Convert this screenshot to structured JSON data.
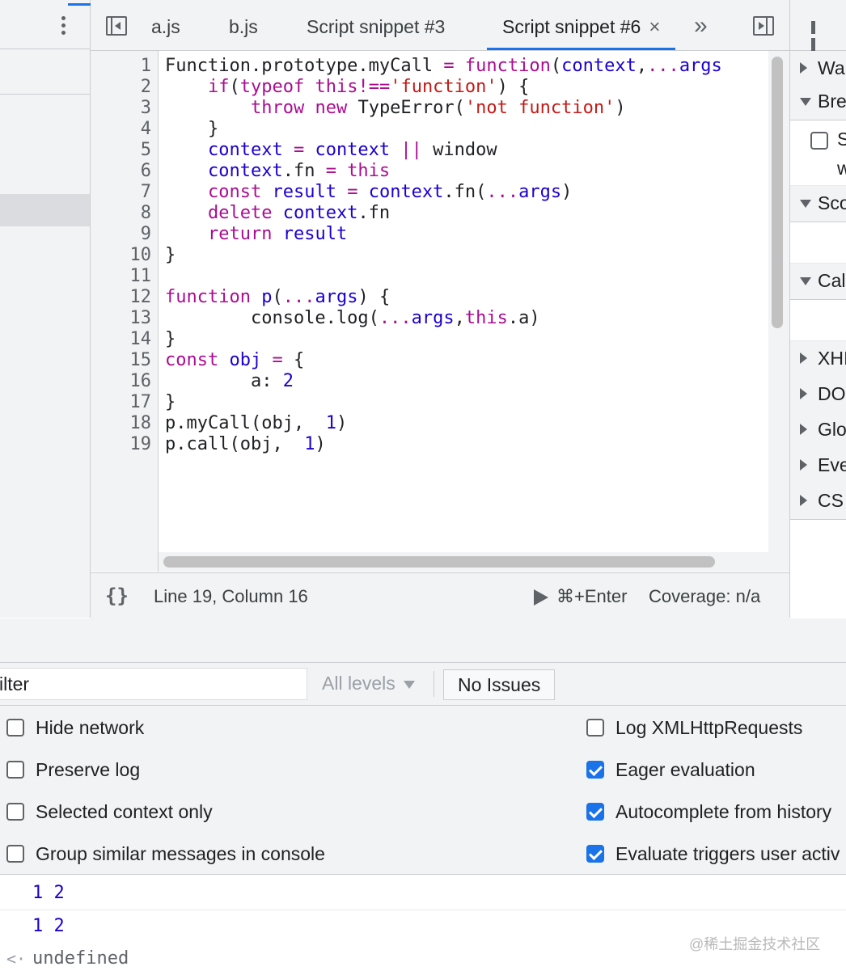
{
  "editor": {
    "tabs": [
      {
        "label": "a.js"
      },
      {
        "label": "b.js"
      },
      {
        "label": "Script snippet #3"
      },
      {
        "label": "Script snippet #6",
        "active": true,
        "close": "×"
      }
    ],
    "more_tabs": "»",
    "code": [
      {
        "n": "1",
        "tokens": [
          [
            "p",
            "Function.prototype.myCall "
          ],
          [
            "op",
            "="
          ],
          [
            "p",
            " "
          ],
          [
            "k",
            "function"
          ],
          [
            "p",
            "("
          ],
          [
            "v",
            "context"
          ],
          [
            "p",
            ","
          ],
          [
            "op",
            "..."
          ],
          [
            "v",
            "args"
          ]
        ]
      },
      {
        "n": "2",
        "tokens": [
          [
            "p",
            "    "
          ],
          [
            "k",
            "if"
          ],
          [
            "p",
            "("
          ],
          [
            "k",
            "typeof"
          ],
          [
            "p",
            " "
          ],
          [
            "k",
            "this"
          ],
          [
            "op",
            "!=="
          ],
          [
            "s",
            "'function'"
          ],
          [
            "p",
            ") {"
          ]
        ]
      },
      {
        "n": "3",
        "tokens": [
          [
            "p",
            "        "
          ],
          [
            "k",
            "throw"
          ],
          [
            "p",
            " "
          ],
          [
            "k",
            "new"
          ],
          [
            "p",
            " TypeError("
          ],
          [
            "s",
            "'not function'"
          ],
          [
            "p",
            ")"
          ]
        ]
      },
      {
        "n": "4",
        "tokens": [
          [
            "p",
            "    }"
          ]
        ]
      },
      {
        "n": "5",
        "tokens": [
          [
            "p",
            "    "
          ],
          [
            "v",
            "context"
          ],
          [
            "p",
            " "
          ],
          [
            "op",
            "="
          ],
          [
            "p",
            " "
          ],
          [
            "v",
            "context"
          ],
          [
            "p",
            " "
          ],
          [
            "op",
            "||"
          ],
          [
            "p",
            " window"
          ]
        ]
      },
      {
        "n": "6",
        "tokens": [
          [
            "p",
            "    "
          ],
          [
            "v",
            "context"
          ],
          [
            "p",
            ".fn "
          ],
          [
            "op",
            "="
          ],
          [
            "p",
            " "
          ],
          [
            "k",
            "this"
          ]
        ]
      },
      {
        "n": "7",
        "tokens": [
          [
            "p",
            "    "
          ],
          [
            "k",
            "const"
          ],
          [
            "p",
            " "
          ],
          [
            "v",
            "result"
          ],
          [
            "p",
            " "
          ],
          [
            "op",
            "="
          ],
          [
            "p",
            " "
          ],
          [
            "v",
            "context"
          ],
          [
            "p",
            ".fn("
          ],
          [
            "op",
            "..."
          ],
          [
            "v",
            "args"
          ],
          [
            "p",
            ")"
          ]
        ]
      },
      {
        "n": "8",
        "tokens": [
          [
            "p",
            "    "
          ],
          [
            "k",
            "delete"
          ],
          [
            "p",
            " "
          ],
          [
            "v",
            "context"
          ],
          [
            "p",
            ".fn"
          ]
        ]
      },
      {
        "n": "9",
        "tokens": [
          [
            "p",
            "    "
          ],
          [
            "k",
            "return"
          ],
          [
            "p",
            " "
          ],
          [
            "v",
            "result"
          ]
        ]
      },
      {
        "n": "10",
        "tokens": [
          [
            "p",
            "}"
          ]
        ]
      },
      {
        "n": "11",
        "tokens": []
      },
      {
        "n": "12",
        "tokens": [
          [
            "k",
            "function"
          ],
          [
            "p",
            " "
          ],
          [
            "v",
            "p"
          ],
          [
            "p",
            "("
          ],
          [
            "op",
            "..."
          ],
          [
            "v",
            "args"
          ],
          [
            "p",
            ") {"
          ]
        ]
      },
      {
        "n": "13",
        "tokens": [
          [
            "p",
            "        console.log("
          ],
          [
            "op",
            "..."
          ],
          [
            "v",
            "args"
          ],
          [
            "p",
            ","
          ],
          [
            "k",
            "this"
          ],
          [
            "p",
            ".a)"
          ]
        ]
      },
      {
        "n": "14",
        "tokens": [
          [
            "p",
            "}"
          ]
        ]
      },
      {
        "n": "15",
        "tokens": [
          [
            "k",
            "const"
          ],
          [
            "p",
            " "
          ],
          [
            "v",
            "obj"
          ],
          [
            "p",
            " "
          ],
          [
            "op",
            "="
          ],
          [
            "p",
            " {"
          ]
        ]
      },
      {
        "n": "16",
        "tokens": [
          [
            "p",
            "        a: "
          ],
          [
            "n",
            "2"
          ]
        ]
      },
      {
        "n": "17",
        "tokens": [
          [
            "p",
            "}"
          ]
        ]
      },
      {
        "n": "18",
        "tokens": [
          [
            "p",
            "p.myCall(obj,  "
          ],
          [
            "n",
            "1"
          ],
          [
            "p",
            ")"
          ]
        ]
      },
      {
        "n": "19",
        "tokens": [
          [
            "p",
            "p.call(obj,  "
          ],
          [
            "n",
            "1"
          ],
          [
            "p",
            ")"
          ]
        ]
      }
    ],
    "status": {
      "format_icon": "{}",
      "position": "Line 19, Column 16",
      "run_shortcut": "⌘+Enter",
      "coverage": "Coverage: n/a"
    }
  },
  "sidebar": {
    "sections": [
      {
        "label": "Wa",
        "expanded": false
      },
      {
        "label": "Bre",
        "expanded": true
      },
      {
        "label": "Sco",
        "expanded": true
      },
      {
        "label": "Cal",
        "expanded": true
      },
      {
        "label": "XHI",
        "expanded": false
      },
      {
        "label": "DO",
        "expanded": false
      },
      {
        "label": "Glo",
        "expanded": false
      },
      {
        "label": "Eve",
        "expanded": false
      },
      {
        "label": "CS",
        "expanded": false
      }
    ],
    "breakpoint_row": {
      "line1": "S",
      "line2": "w"
    }
  },
  "console": {
    "filter_value": "ilter",
    "levels": "All levels",
    "issues": "No Issues",
    "options_left": [
      {
        "label": "Hide network",
        "checked": false
      },
      {
        "label": "Preserve log",
        "checked": false
      },
      {
        "label": "Selected context only",
        "checked": false
      },
      {
        "label": "Group similar messages in console",
        "checked": false
      }
    ],
    "options_right": [
      {
        "label": "Log XMLHttpRequests",
        "checked": false
      },
      {
        "label": "Eager evaluation",
        "checked": true
      },
      {
        "label": "Autocomplete from history",
        "checked": true
      },
      {
        "label": "Evaluate triggers user activ",
        "checked": true
      }
    ],
    "output": [
      {
        "text": "1 2",
        "kind": "log"
      },
      {
        "text": "1 2",
        "kind": "log"
      },
      {
        "text": "undefined",
        "kind": "result",
        "prefix": "<·"
      }
    ]
  },
  "watermark": "@稀土掘金技术社区",
  "colors": {
    "accent": "#1a73e8",
    "keyword": "#aa0d91",
    "variable": "#1c00cf",
    "string": "#c41a16"
  }
}
